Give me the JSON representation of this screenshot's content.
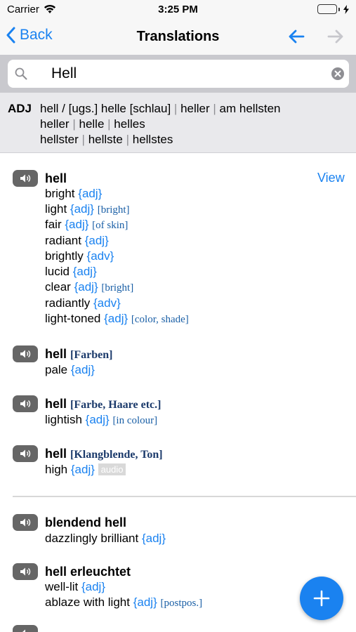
{
  "status": {
    "carrier": "Carrier",
    "time": "3:25 PM"
  },
  "nav": {
    "back_label": "Back",
    "title": "Translations"
  },
  "search": {
    "value": "Hell",
    "placeholder": ""
  },
  "inflection": {
    "pos": "ADJ",
    "row1": [
      "hell / [ugs.] helle [schlau]",
      "heller",
      "am hellsten"
    ],
    "row2": [
      "heller",
      "helle",
      "helles"
    ],
    "row3": [
      "hellster",
      "hellste",
      "hellstes"
    ]
  },
  "view_label": "View",
  "entries": [
    {
      "head": "hell",
      "context": "",
      "translations": [
        {
          "text": "bright",
          "pos": "{adj}",
          "note": ""
        },
        {
          "text": "light",
          "pos": "{adj}",
          "note": "[bright]"
        },
        {
          "text": "fair",
          "pos": "{adj}",
          "note": "[of skin]"
        },
        {
          "text": "radiant",
          "pos": "{adj}",
          "note": ""
        },
        {
          "text": "brightly",
          "pos": "{adv}",
          "note": ""
        },
        {
          "text": "lucid",
          "pos": "{adj}",
          "note": ""
        },
        {
          "text": "clear",
          "pos": "{adj}",
          "note": "[bright]"
        },
        {
          "text": "radiantly",
          "pos": "{adv}",
          "note": ""
        },
        {
          "text": "light-toned",
          "pos": "{adj}",
          "note": "[color, shade]"
        }
      ]
    },
    {
      "head": "hell",
      "context": "[Farben]",
      "translations": [
        {
          "text": "pale",
          "pos": "{adj}",
          "note": ""
        }
      ]
    },
    {
      "head": "hell",
      "context": "[Farbe, Haare etc.]",
      "translations": [
        {
          "text": "lightish",
          "pos": "{adj}",
          "note": "[in colour]"
        }
      ]
    },
    {
      "head": "hell",
      "context": "[Klangblende, Ton]",
      "translations": [
        {
          "text": "high",
          "pos": "{adj}",
          "note": "",
          "tag": "audio"
        }
      ]
    },
    {
      "head": "blendend hell",
      "context": "",
      "translations": [
        {
          "text": "dazzlingly brilliant",
          "pos": "{adj}",
          "note": ""
        }
      ]
    },
    {
      "head": "hell erleuchtet",
      "context": "",
      "translations": [
        {
          "text": "well-lit",
          "pos": "{adj}",
          "note": ""
        },
        {
          "text": "ablaze with light",
          "pos": "{adj}",
          "note": "[postpos.]"
        }
      ]
    }
  ],
  "icons": {
    "back": "chevron-left-icon",
    "nav_prev": "arrow-left-icon",
    "nav_next": "arrow-right-icon",
    "search": "magnifier-icon",
    "clear": "clear-circle-icon",
    "speaker": "speaker-icon",
    "add": "plus-icon",
    "wifi": "wifi-icon",
    "battery": "battery-icon"
  },
  "colors": {
    "accent": "#1a82f0",
    "context": "#1b3a6b",
    "battery": "#4cd964",
    "battery_level": 1.0
  }
}
